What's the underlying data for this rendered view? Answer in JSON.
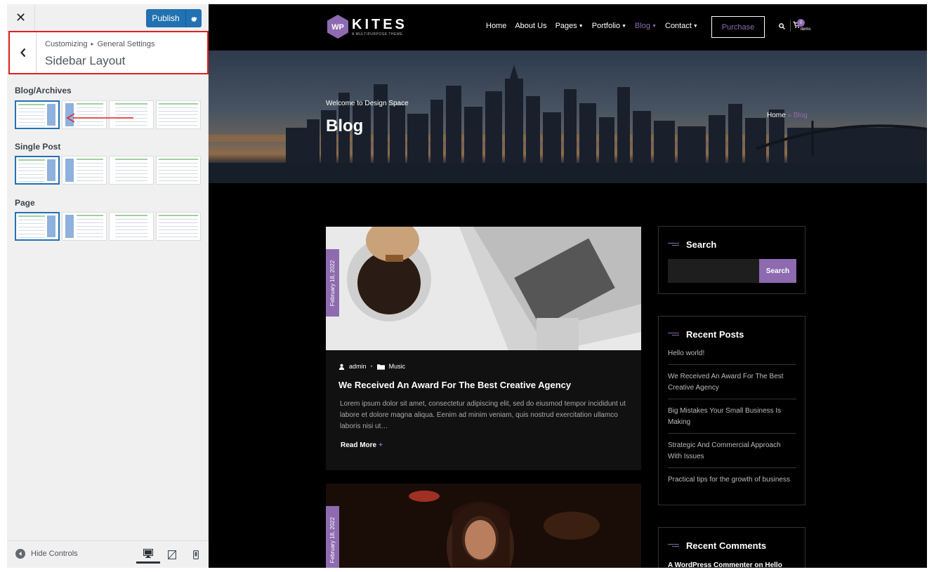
{
  "customizer": {
    "close_glyph": "✕",
    "publish_label": "Publish",
    "breadcrumb": {
      "root": "Customizing",
      "separator": "▸",
      "section": "General Settings"
    },
    "section_title": "Sidebar Layout",
    "controls": [
      {
        "label": "Blog/Archives",
        "options": [
          "right-sidebar",
          "left-sidebar",
          "no-sidebar",
          "full-width"
        ],
        "selected": "right-sidebar"
      },
      {
        "label": "Single Post",
        "options": [
          "right-sidebar",
          "left-sidebar",
          "no-sidebar",
          "full-width"
        ],
        "selected": "right-sidebar"
      },
      {
        "label": "Page",
        "options": [
          "right-sidebar",
          "left-sidebar",
          "no-sidebar",
          "full-width"
        ],
        "selected": "right-sidebar"
      }
    ],
    "footer": {
      "hide_controls": "Hide Controls",
      "devices": [
        "desktop",
        "tablet",
        "mobile"
      ],
      "active_device": "desktop"
    },
    "accent_color": "#2271b1",
    "highlight_color": "#e02020"
  },
  "site": {
    "logo": {
      "mark": "WP",
      "word": "KITES",
      "tagline": "A MULTIPURPOSE THEME"
    },
    "menu": [
      {
        "label": "Home",
        "dropdown": false,
        "active": false
      },
      {
        "label": "About Us",
        "dropdown": false,
        "active": false
      },
      {
        "label": "Pages",
        "dropdown": true,
        "active": false
      },
      {
        "label": "Portfolio",
        "dropdown": true,
        "active": false
      },
      {
        "label": "Blog",
        "dropdown": true,
        "active": true
      },
      {
        "label": "Contact",
        "dropdown": true,
        "active": false
      }
    ],
    "purchase_label": "Purchase",
    "cart": {
      "count": "0",
      "items_label": "items"
    },
    "hero": {
      "subtitle": "Welcome to Design Space",
      "title": "Blog",
      "crumb_home": "Home",
      "crumb_sep": " » ",
      "crumb_current": "Blog"
    },
    "posts": [
      {
        "date": "February 18, 2022",
        "author": "admin",
        "category": "Music",
        "title": "We Received An Award For The Best Creative Agency",
        "excerpt": "Lorem ipsum dolor sit amet, consectetur adipiscing elit, sed do eiusmod tempor incididunt ut labore et dolore magna aliqua. Eenim ad minim veniam, quis nostrud exercitation ullamco laboris nisi ut…",
        "read_more": "Read More"
      },
      {
        "date": "February 18, 2022"
      }
    ],
    "sidebar": {
      "search": {
        "title": "Search",
        "button": "Search"
      },
      "recent_posts": {
        "title": "Recent Posts",
        "items": [
          "Hello world!",
          "We Received An Award For The Best Creative Agency",
          "Big Mistakes Your Small Business Is Making",
          "Strategic And Commercial Approach With Issues",
          "Practical tips for the growth of business"
        ]
      },
      "recent_comments": {
        "title": "Recent Comments",
        "first": "A WordPress Commenter on Hello"
      }
    },
    "brand_color": "#8e6bb0"
  }
}
